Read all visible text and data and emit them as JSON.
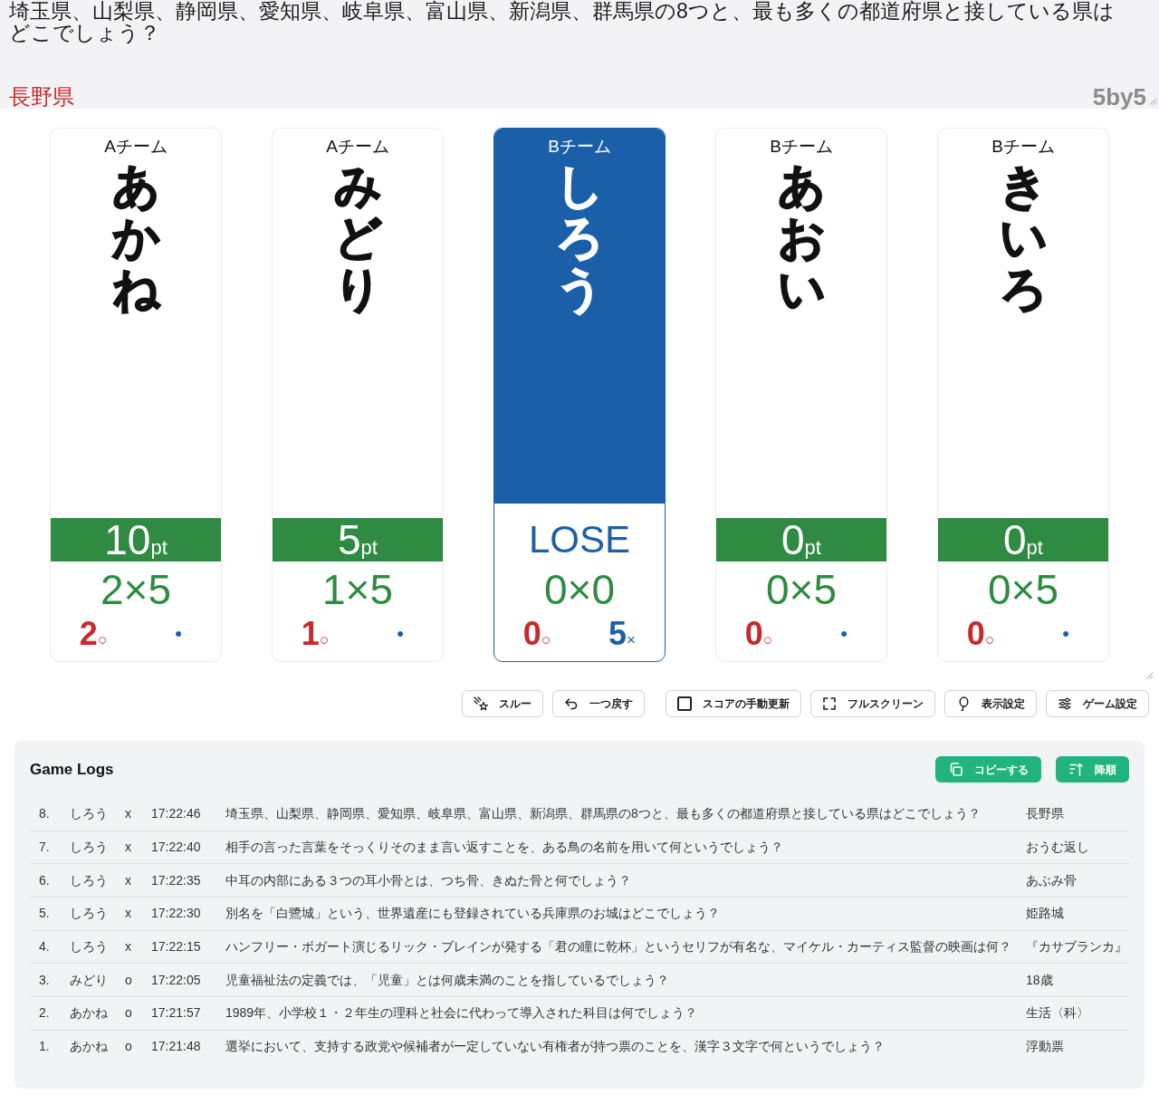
{
  "question": {
    "text": "埼玉県、山梨県、静岡県、愛知県、岐阜県、富山県、新潟県、群馬県の8つと、最も多くの都道府県と接している県はどこでしょう？",
    "answer": "長野県",
    "rule": "5by5"
  },
  "players": [
    {
      "team": "Aチーム",
      "name": "あかね",
      "lost": false,
      "points": "10",
      "unit": "pt",
      "formula": "2×5",
      "correct": "2",
      "correct_mark": "○",
      "wrong": "•"
    },
    {
      "team": "Aチーム",
      "name": "みどり",
      "lost": false,
      "points": "5",
      "unit": "pt",
      "formula": "1×5",
      "correct": "1",
      "correct_mark": "○",
      "wrong": "•"
    },
    {
      "team": "Bチーム",
      "name": "しろう",
      "lost": true,
      "status": "LOSE",
      "formula": "0×0",
      "correct": "0",
      "correct_mark": "○",
      "wrong": "5",
      "wrong_mark": "×"
    },
    {
      "team": "Bチーム",
      "name": "あおい",
      "lost": false,
      "points": "0",
      "unit": "pt",
      "formula": "0×5",
      "correct": "0",
      "correct_mark": "○",
      "wrong": "•"
    },
    {
      "team": "Bチーム",
      "name": "きいろ",
      "lost": false,
      "points": "0",
      "unit": "pt",
      "formula": "0×5",
      "correct": "0",
      "correct_mark": "○",
      "wrong": "•"
    }
  ],
  "controls": [
    {
      "kind": "button",
      "label": "スルー"
    },
    {
      "kind": "button",
      "label": "一つ戻す"
    },
    {
      "kind": "checkbox",
      "label": "スコアの手動更新",
      "checked": false
    },
    {
      "kind": "button",
      "label": "フルスクリーン"
    },
    {
      "kind": "button",
      "label": "表示設定"
    },
    {
      "kind": "button",
      "label": "ゲーム設定"
    }
  ],
  "logs": {
    "title": "Game Logs",
    "actions": [
      "コピーする",
      "降順"
    ],
    "rows": [
      {
        "number": "8.",
        "player": "しろう",
        "result": "x",
        "time": "17:22:46",
        "question": "埼玉県、山梨県、静岡県、愛知県、岐阜県、富山県、新潟県、群馬県の8つと、最も多くの都道府県と接している県はどこでしょう？",
        "answer": "長野県"
      },
      {
        "number": "7.",
        "player": "しろう",
        "result": "x",
        "time": "17:22:40",
        "question": "相手の言った言葉をそっくりそのまま言い返すことを、ある鳥の名前を用いて何というでしょう？",
        "answer": "おうむ返し"
      },
      {
        "number": "6.",
        "player": "しろう",
        "result": "x",
        "time": "17:22:35",
        "question": "中耳の内部にある３つの耳小骨とは、つち骨、きぬた骨と何でしょう？",
        "answer": "あぶみ骨"
      },
      {
        "number": "5.",
        "player": "しろう",
        "result": "x",
        "time": "17:22:30",
        "question": "別名を「白鷺城」という、世界遺産にも登録されている兵庫県のお城はどこでしょう？",
        "answer": "姫路城"
      },
      {
        "number": "4.",
        "player": "しろう",
        "result": "x",
        "time": "17:22:15",
        "question": "ハンフリー・ボガート演じるリック・ブレインが発する「君の瞳に乾杯」というセリフが有名な、マイケル・カーティス監督の映画は何？",
        "answer": "『カサブランカ』"
      },
      {
        "number": "3.",
        "player": "みどり",
        "result": "o",
        "time": "17:22:05",
        "question": "児童福祉法の定義では、「児童」とは何歳未満のことを指しているでしょう？",
        "answer": "18歳"
      },
      {
        "number": "2.",
        "player": "あかね",
        "result": "o",
        "time": "17:21:57",
        "question": "1989年、小学校１・２年生の理科と社会に代わって導入された科目は何でしょう？",
        "answer": "生活〈科〉"
      },
      {
        "number": "1.",
        "player": "あかね",
        "result": "o",
        "time": "17:21:48",
        "question": "選挙において、支持する政党や候補者が一定していない有権者が持つ票のことを、漢字３文字で何というでしょう？",
        "answer": "浮動票"
      }
    ]
  }
}
